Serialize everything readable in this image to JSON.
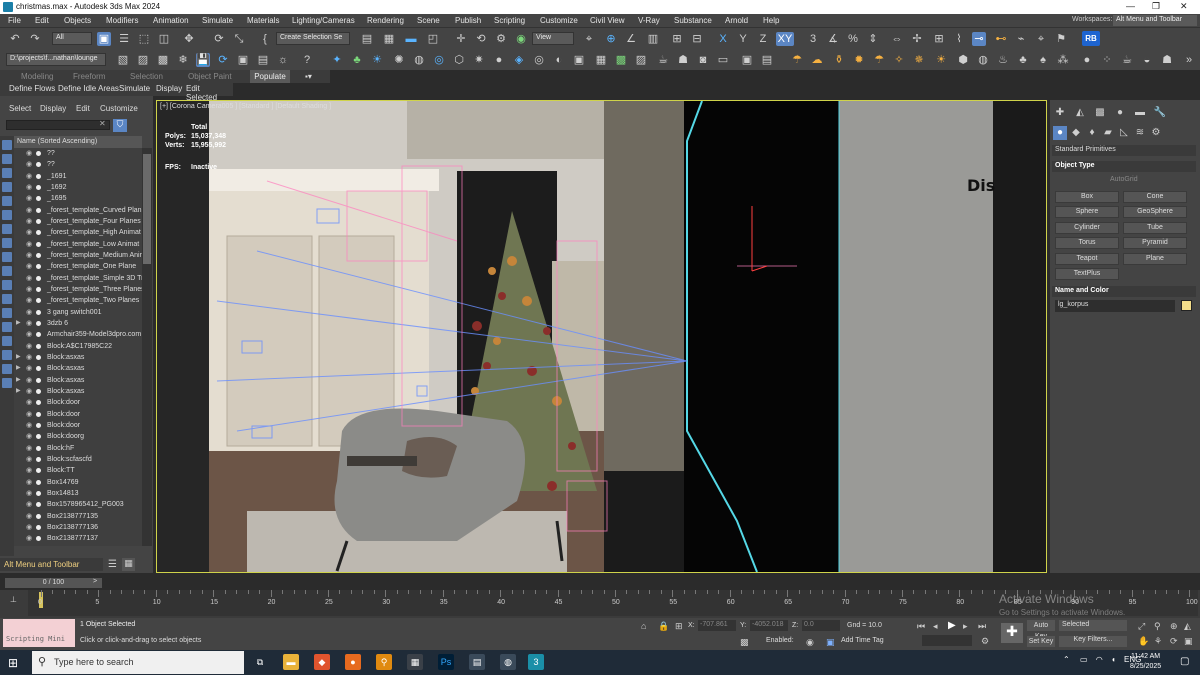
{
  "window": {
    "title": "christmas.max - Autodesk 3ds Max 2024",
    "minimize": "—",
    "restore": "❐",
    "close": "✕"
  },
  "menu": [
    "File",
    "Edit",
    "Objects",
    "Modifiers",
    "Animation",
    "Simulate",
    "Materials",
    "Lighting/Cameras",
    "Rendering",
    "Scene",
    "Publish",
    "Scripting",
    "Customize",
    "Civil View",
    "V-Ray",
    "Substance",
    "Arnold",
    "Help"
  ],
  "workspaces": {
    "label": "Workspaces:",
    "value": "Alt Menu and Toolbar"
  },
  "toolbar": {
    "filter_value": "All",
    "named_selection_placeholder": "Create Selection Se",
    "view_value": "View",
    "axis_x": "X",
    "axis_y": "Y",
    "axis_z": "Z",
    "axis_xy": "XY",
    "rb_label": "RB"
  },
  "toolbar2": {
    "project_path": "D:\\projects\\f...nathan\\lounge"
  },
  "ribbon": {
    "tabs": [
      "Modeling",
      "Freeform",
      "Selection",
      "Object Paint",
      "Populate"
    ],
    "active": "Populate"
  },
  "ribbon_sub": [
    "Define Flows",
    "Define Idle Areas",
    "Simulate",
    "Display",
    "Edit Selected"
  ],
  "scene_explorer": {
    "tabs": [
      "Select",
      "Display",
      "Edit",
      "Customize"
    ],
    "header": "Name (Sorted Ascending)",
    "items": [
      {
        "name": "??",
        "expand": ""
      },
      {
        "name": "??",
        "expand": ""
      },
      {
        "name": "_1691",
        "expand": ""
      },
      {
        "name": "_1692",
        "expand": ""
      },
      {
        "name": "_1695",
        "expand": ""
      },
      {
        "name": "_forest_template_Curved Plan",
        "expand": ""
      },
      {
        "name": "_forest_template_Four Planes",
        "expand": ""
      },
      {
        "name": "_forest_template_High Animat",
        "expand": ""
      },
      {
        "name": "_forest_template_Low Animat",
        "expand": ""
      },
      {
        "name": "_forest_template_Medium Anim",
        "expand": ""
      },
      {
        "name": "_forest_template_One Plane",
        "expand": ""
      },
      {
        "name": "_forest_template_Simple 3D Tr",
        "expand": ""
      },
      {
        "name": "_forest_template_Three Planes",
        "expand": ""
      },
      {
        "name": "_forest_template_Two Planes",
        "expand": ""
      },
      {
        "name": "3 gang switch001",
        "expand": ""
      },
      {
        "name": "3dzb 6",
        "expand": "▶"
      },
      {
        "name": "Armchair359-Model3dpro.com",
        "expand": ""
      },
      {
        "name": "Block:A$C17985C22",
        "expand": ""
      },
      {
        "name": "Block:asxas",
        "expand": "▶"
      },
      {
        "name": "Block:asxas",
        "expand": "▶"
      },
      {
        "name": "Block:asxas",
        "expand": "▶"
      },
      {
        "name": "Block:asxas",
        "expand": "▶"
      },
      {
        "name": "Block:door",
        "expand": ""
      },
      {
        "name": "Block:door",
        "expand": ""
      },
      {
        "name": "Block:door",
        "expand": ""
      },
      {
        "name": "Block:doorg",
        "expand": ""
      },
      {
        "name": "Block:hF",
        "expand": ""
      },
      {
        "name": "Block:scfascfd",
        "expand": ""
      },
      {
        "name": "Block:TT",
        "expand": ""
      },
      {
        "name": "Box14769",
        "expand": ""
      },
      {
        "name": "Box14813",
        "expand": ""
      },
      {
        "name": "Box1578965412_PG003",
        "expand": ""
      },
      {
        "name": "Box2138777135",
        "expand": ""
      },
      {
        "name": "Box2138777136",
        "expand": ""
      },
      {
        "name": "Box2138777137",
        "expand": ""
      }
    ],
    "workspace_label": "Alt Menu and Toolbar"
  },
  "frame_counter": "0 / 100",
  "viewport": {
    "label": "[+] [Corona Camera005 ] [Standard ] [Default Shading ]",
    "stats_title": "Total",
    "polys_label": "Polys:",
    "polys_value": "15,037,348",
    "verts_label": "Verts:",
    "verts_value": "15,955,992",
    "fps_label": "FPS:",
    "fps_value": "Inactive"
  },
  "command_panel": {
    "category": "Standard Primitives",
    "object_type_title": "Object Type",
    "autogrid": "AutoGrid",
    "buttons": [
      "Box",
      "Cone",
      "Sphere",
      "GeoSphere",
      "Cylinder",
      "Tube",
      "Torus",
      "Pyramid",
      "Teapot",
      "Plane",
      "TextPlus"
    ],
    "name_color_title": "Name and Color",
    "object_name": "lg_korpus",
    "object_color": "#f3dd8a"
  },
  "timeline": {
    "ticks": [
      "0",
      "5",
      "10",
      "15",
      "20",
      "25",
      "30",
      "35",
      "40",
      "45",
      "50",
      "55",
      "60",
      "65",
      "70",
      "75",
      "80",
      "85",
      "90",
      "95",
      "100"
    ]
  },
  "status": {
    "maxscript": "Scripting Mini",
    "selection": "1 Object Selected",
    "prompt": "Click or click-and-drag to select objects",
    "x_label": "X:",
    "x_value": "-707.861",
    "y_label": "Y:",
    "y_value": "-4052.018",
    "z_label": "Z:",
    "z_value": "0.0",
    "grid": "Gnd = 10.0",
    "enabled": "Enabled:",
    "add_time_tag": "Add Time Tag",
    "auto_key": "Auto Key",
    "set_key": "Set Key",
    "selected": "Selected",
    "key_filters": "Key Filters..."
  },
  "watermark": {
    "line1": "Activate Windows",
    "line2": "Go to Settings to activate Windows."
  },
  "taskbar": {
    "search_placeholder": "Type here to search",
    "lang": "ENG",
    "time": "11:42 AM",
    "date": "8/25/2025"
  }
}
